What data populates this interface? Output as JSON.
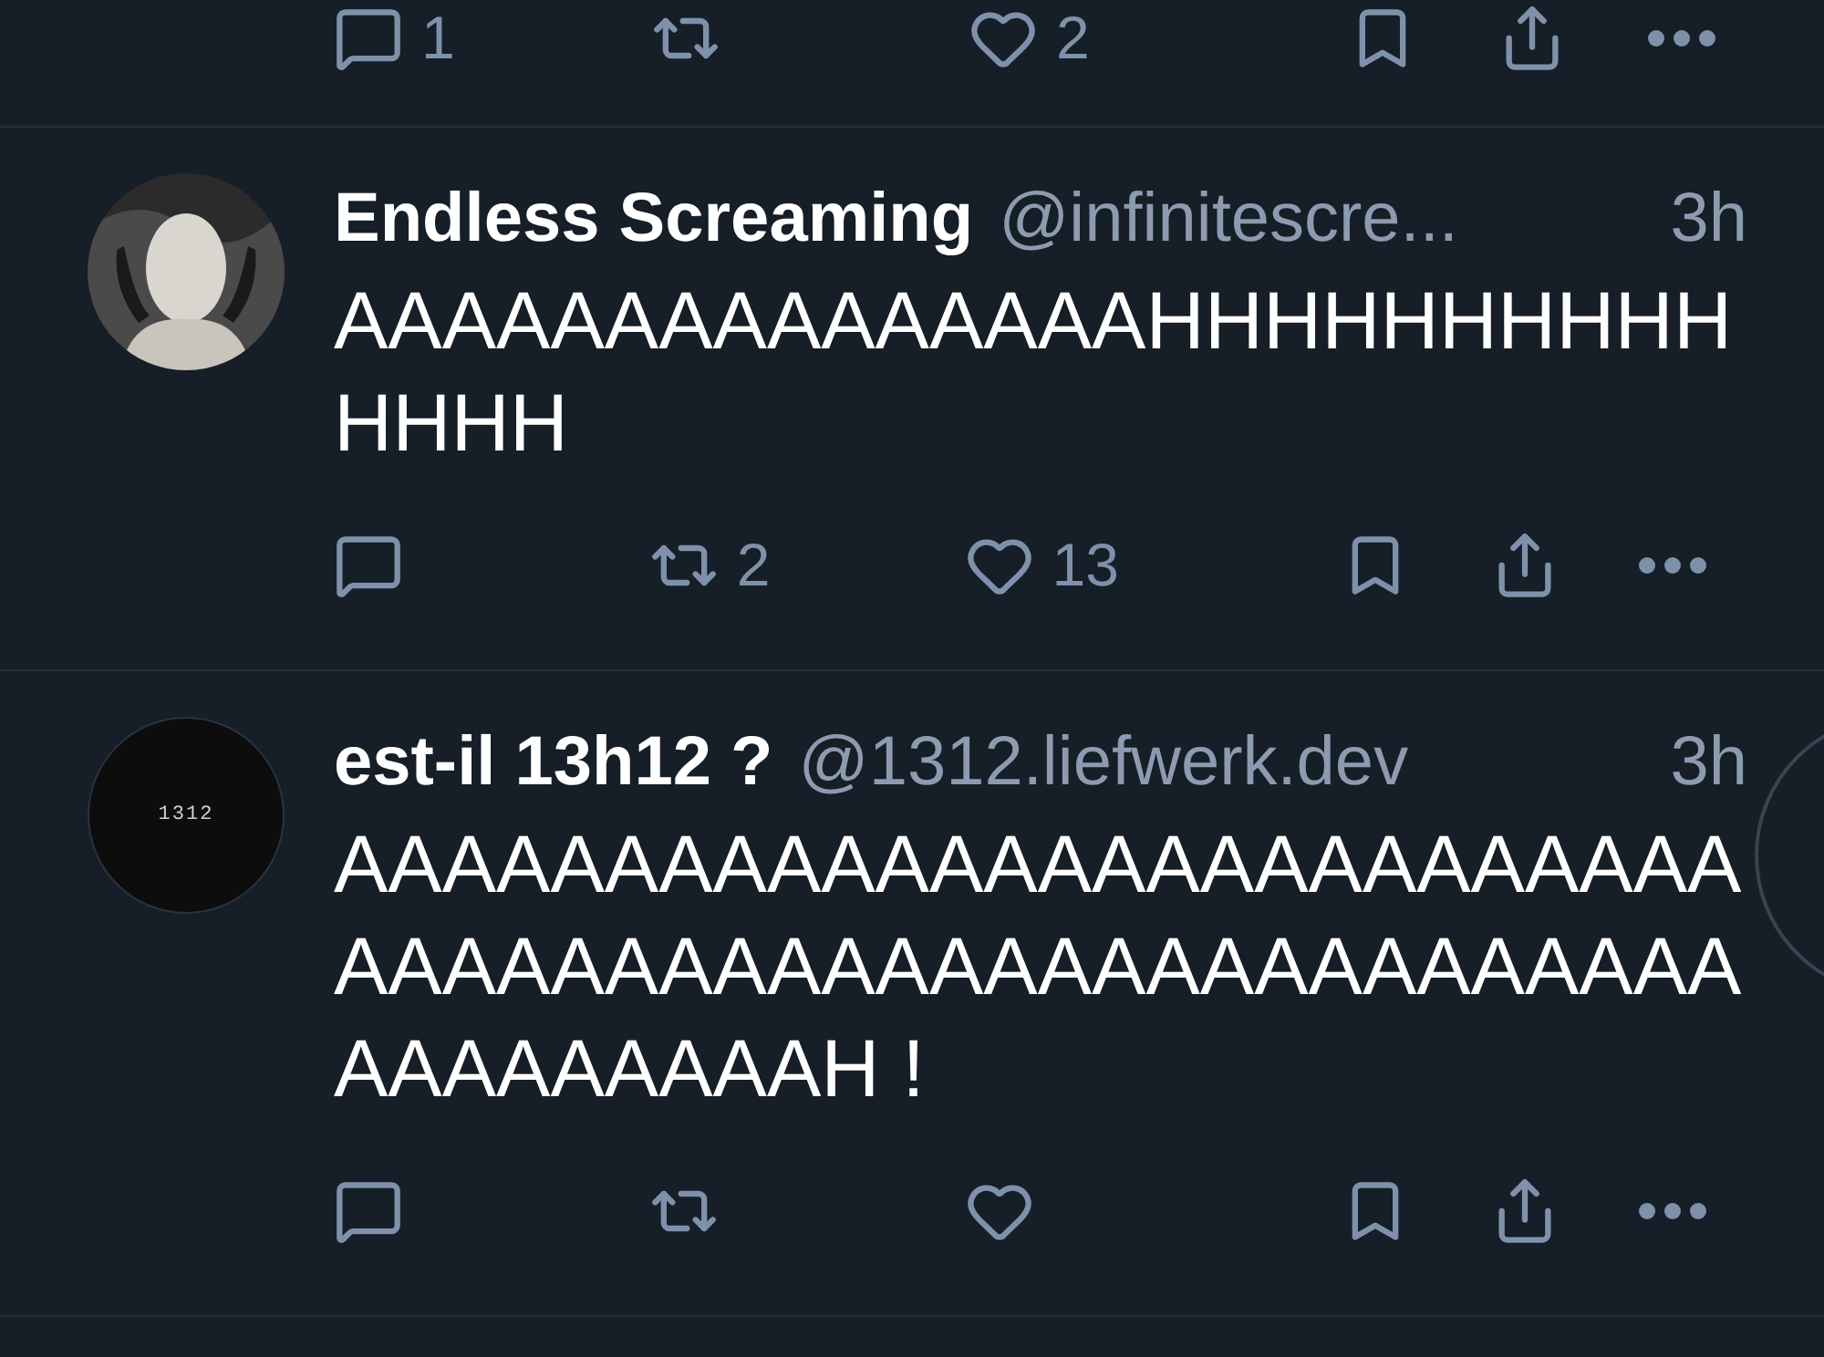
{
  "previous_post": {
    "actions": [
      {
        "kind": "reply",
        "count": "1"
      },
      {
        "kind": "repost"
      },
      {
        "kind": "like",
        "count": "2"
      },
      {
        "kind": "bookmark"
      },
      {
        "kind": "share"
      },
      {
        "kind": "more"
      }
    ]
  },
  "posts": [
    {
      "name": "Endless Screaming",
      "handle": "@infinitescre...",
      "time": "3h",
      "text": "AAAAAAAAAAAAAAAHHHHHHHHHHHHHH",
      "actions": [
        {
          "kind": "reply"
        },
        {
          "kind": "repost",
          "count": "2"
        },
        {
          "kind": "like",
          "count": "13"
        },
        {
          "kind": "bookmark"
        },
        {
          "kind": "share"
        },
        {
          "kind": "more"
        }
      ]
    },
    {
      "avatar": {
        "kind": "label",
        "label": "1312"
      },
      "name": "est-il 13h12 ?",
      "handle": "@1312.liefwerk.dev",
      "time": "3h",
      "text": "AAAAAAAAAAAAAAAAAAAAAAAAAAAAAAAAAAAAAAAAAAAAAAAAAAAAAAAAAAAAAH !",
      "actions": [
        {
          "kind": "reply"
        },
        {
          "kind": "repost"
        },
        {
          "kind": "like"
        },
        {
          "kind": "bookmark"
        },
        {
          "kind": "share"
        },
        {
          "kind": "more"
        }
      ]
    }
  ]
}
